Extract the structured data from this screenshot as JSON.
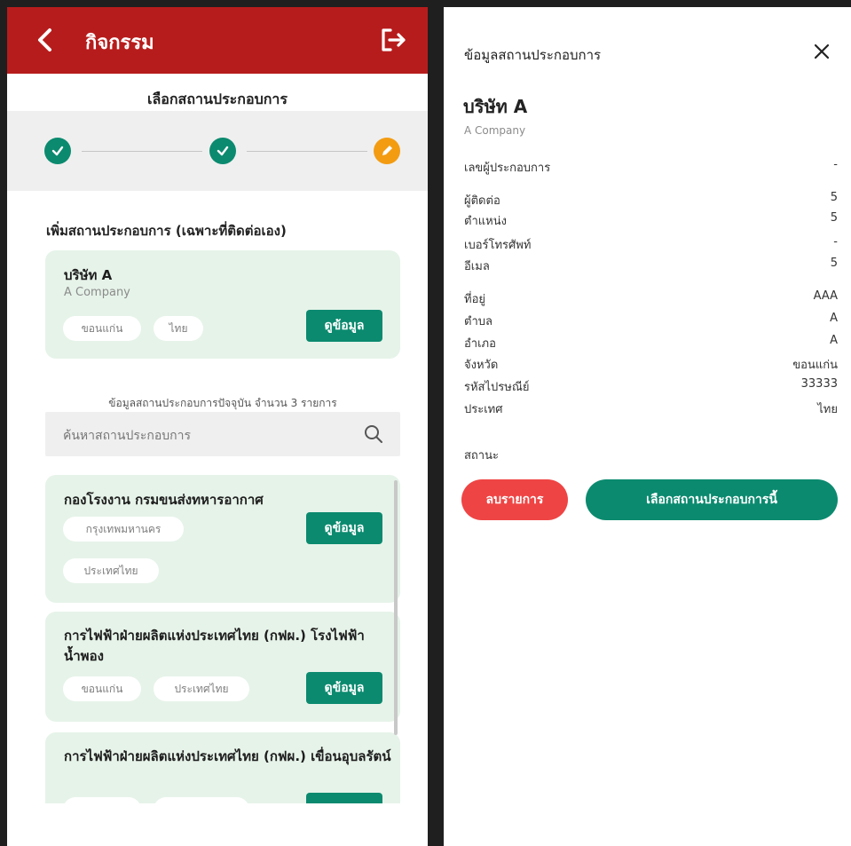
{
  "header": {
    "title": "กิจกรรม",
    "back_icon": "chevron-left-icon",
    "logout_icon": "logout-icon"
  },
  "stepper": {
    "title": "เลือกสถานประกอบการ",
    "steps": [
      {
        "state": "done",
        "icon": "check-icon"
      },
      {
        "state": "done",
        "icon": "check-icon"
      },
      {
        "state": "current",
        "icon": "pencil-icon"
      }
    ],
    "done_color": "#0b8a6f",
    "current_color": "#f39c12"
  },
  "own_section": {
    "heading": "เพิ่มสถานประกอบการ (เฉพาะที่ติดต่อเอง)",
    "card": {
      "name": "บริษัท A",
      "name_en": "A Company",
      "chips": [
        "ขอนแก่น",
        "ไทย"
      ],
      "button": "ดูข้อมูล"
    }
  },
  "list": {
    "count_text": "ข้อมูลสถานประกอบการปัจจุบัน จำนวน 3 รายการ",
    "search_placeholder": "ค้นหาสถานประกอบการ",
    "items": [
      {
        "title": "กองโรงงาน กรมขนส่งทหารอากาศ",
        "chips": [
          "กรุงเทพมหานคร",
          "ประเทศไทย"
        ],
        "button": "ดูข้อมูล"
      },
      {
        "title": "การไฟฟ้าฝ่ายผลิตแห่งประเทศไทย (กฟผ.) โรงไฟฟ้าน้ำพอง",
        "chips": [
          "ขอนแก่น",
          "ประเทศไทย"
        ],
        "button": "ดูข้อมูล"
      },
      {
        "title": "การไฟฟ้าฝ่ายผลิตแห่งประเทศไทย (กฟผ.) เขื่อนอุบลรัตน์",
        "chips": [
          "",
          ""
        ],
        "button": ""
      }
    ]
  },
  "detail": {
    "title": "ข้อมูลสถานประกอบการ",
    "close_icon": "close-icon",
    "company": "บริษัท A",
    "company_en": "A Company",
    "rows": [
      {
        "label": "เลขผู้ประกอบการ",
        "value": "-"
      },
      {
        "label": "ผู้ติดต่อ",
        "value": "5"
      },
      {
        "label": "ตำแหน่ง",
        "value": "5"
      },
      {
        "label": "เบอร์โทรศัพท์",
        "value": "-"
      },
      {
        "label": "อีเมล",
        "value": "5"
      },
      {
        "label": "ที่อยู่",
        "value": "AAA"
      },
      {
        "label": "ตำบล",
        "value": "A"
      },
      {
        "label": "อำเภอ",
        "value": "A"
      },
      {
        "label": "จังหวัด",
        "value": "ขอนแก่น"
      },
      {
        "label": "รหัสไปรษณีย์",
        "value": "33333"
      },
      {
        "label": "ประเทศ",
        "value": "ไทย"
      }
    ],
    "status_label": "สถานะ",
    "delete_button": "ลบรายการ",
    "select_button": "เลือกสถานประกอบการนี้"
  },
  "colors": {
    "header_red": "#b71c1c",
    "primary_green": "#0b8a6f",
    "danger_red": "#ef4444",
    "card_bg": "#e6f3e9"
  }
}
